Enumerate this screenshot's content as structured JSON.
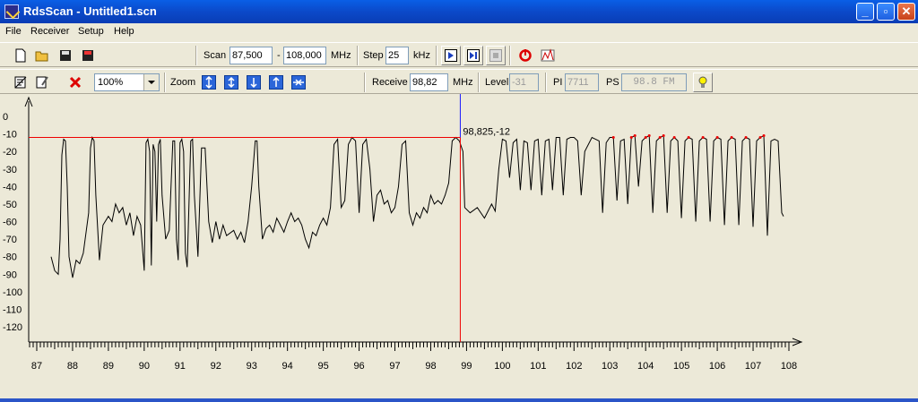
{
  "window": {
    "title": "RdsScan - Untitled1.scn"
  },
  "menu": [
    "File",
    "Receiver",
    "Setup",
    "Help"
  ],
  "toolbar1": {
    "scan_label": "Scan",
    "scan_from": "87,500",
    "scan_sep": "-",
    "scan_to": "108,000",
    "mhz_label": "MHz",
    "step_label": "Step",
    "step_value": "25",
    "khz_label": "kHz"
  },
  "toolbar2": {
    "zoom_value": "100%",
    "zoom_label": "Zoom",
    "receive_label": "Receive",
    "receive_value": "98,82",
    "mhz_label": "MHz",
    "level_label": "Level",
    "level_value": "-31",
    "pi_label": "PI",
    "pi_value": "7711",
    "ps_label": "PS",
    "ps_value": "98.8 FM"
  },
  "chart_data": {
    "type": "line",
    "xlabel": "",
    "ylabel": "",
    "xlim": [
      86.7,
      108.2
    ],
    "ylim": [
      -125,
      0
    ],
    "x_ticks": [
      "87",
      "88",
      "89",
      "90",
      "91",
      "92",
      "93",
      "94",
      "95",
      "96",
      "97",
      "98",
      "99",
      "100",
      "101",
      "102",
      "103",
      "104",
      "105",
      "106",
      "107",
      "108"
    ],
    "y_ticks": [
      "0",
      "-10",
      "-20",
      "-30",
      "-40",
      "-50",
      "-60",
      "-70",
      "-80",
      "-90",
      "-100",
      "-110",
      "-120"
    ],
    "cursor": {
      "x": 98.825,
      "y": -12,
      "label": "98,825,-12"
    },
    "series": [
      {
        "values": [
          [
            87.4,
            -80
          ],
          [
            87.5,
            -88
          ],
          [
            87.6,
            -90
          ],
          [
            87.65,
            -70
          ],
          [
            87.7,
            -22
          ],
          [
            87.75,
            -13
          ],
          [
            87.8,
            -14
          ],
          [
            87.85,
            -40
          ],
          [
            87.9,
            -80
          ],
          [
            88.0,
            -92
          ],
          [
            88.1,
            -82
          ],
          [
            88.2,
            -84
          ],
          [
            88.3,
            -78
          ],
          [
            88.45,
            -55
          ],
          [
            88.5,
            -18
          ],
          [
            88.55,
            -12
          ],
          [
            88.6,
            -14
          ],
          [
            88.65,
            -45
          ],
          [
            88.75,
            -82
          ],
          [
            88.85,
            -62
          ],
          [
            89.0,
            -57
          ],
          [
            89.1,
            -60
          ],
          [
            89.2,
            -50
          ],
          [
            89.3,
            -55
          ],
          [
            89.4,
            -52
          ],
          [
            89.5,
            -62
          ],
          [
            89.6,
            -55
          ],
          [
            89.7,
            -68
          ],
          [
            89.8,
            -57
          ],
          [
            89.9,
            -62
          ],
          [
            90.0,
            -88
          ],
          [
            90.05,
            -15
          ],
          [
            90.1,
            -13
          ],
          [
            90.15,
            -20
          ],
          [
            90.2,
            -85
          ],
          [
            90.25,
            -16
          ],
          [
            90.3,
            -20
          ],
          [
            90.35,
            -60
          ],
          [
            90.4,
            -16
          ],
          [
            90.45,
            -13
          ],
          [
            90.5,
            -45
          ],
          [
            90.6,
            -70
          ],
          [
            90.7,
            -65
          ],
          [
            90.8,
            -14
          ],
          [
            90.85,
            -14
          ],
          [
            90.9,
            -70
          ],
          [
            90.95,
            -82
          ],
          [
            91.0,
            -15
          ],
          [
            91.05,
            -13
          ],
          [
            91.1,
            -20
          ],
          [
            91.15,
            -78
          ],
          [
            91.2,
            -86
          ],
          [
            91.3,
            -14
          ],
          [
            91.35,
            -13
          ],
          [
            91.4,
            -45
          ],
          [
            91.5,
            -80
          ],
          [
            91.6,
            -18
          ],
          [
            91.7,
            -18
          ],
          [
            91.8,
            -60
          ],
          [
            91.9,
            -72
          ],
          [
            92.0,
            -60
          ],
          [
            92.1,
            -70
          ],
          [
            92.2,
            -62
          ],
          [
            92.3,
            -68
          ],
          [
            92.5,
            -65
          ],
          [
            92.6,
            -70
          ],
          [
            92.7,
            -66
          ],
          [
            92.8,
            -72
          ],
          [
            92.9,
            -60
          ],
          [
            93.0,
            -40
          ],
          [
            93.1,
            -14
          ],
          [
            93.15,
            -14
          ],
          [
            93.2,
            -40
          ],
          [
            93.3,
            -70
          ],
          [
            93.4,
            -64
          ],
          [
            93.5,
            -62
          ],
          [
            93.6,
            -66
          ],
          [
            93.7,
            -58
          ],
          [
            93.8,
            -62
          ],
          [
            93.9,
            -66
          ],
          [
            94.0,
            -60
          ],
          [
            94.1,
            -55
          ],
          [
            94.2,
            -60
          ],
          [
            94.3,
            -58
          ],
          [
            94.4,
            -62
          ],
          [
            94.5,
            -70
          ],
          [
            94.6,
            -75
          ],
          [
            94.7,
            -66
          ],
          [
            94.8,
            -68
          ],
          [
            94.9,
            -62
          ],
          [
            95.0,
            -58
          ],
          [
            95.1,
            -62
          ],
          [
            95.2,
            -52
          ],
          [
            95.3,
            -16
          ],
          [
            95.4,
            -13
          ],
          [
            95.5,
            -52
          ],
          [
            95.6,
            -48
          ],
          [
            95.7,
            -16
          ],
          [
            95.8,
            -12
          ],
          [
            95.9,
            -14
          ],
          [
            96.0,
            -55
          ],
          [
            96.1,
            -16
          ],
          [
            96.2,
            -13
          ],
          [
            96.3,
            -30
          ],
          [
            96.4,
            -60
          ],
          [
            96.5,
            -45
          ],
          [
            96.6,
            -42
          ],
          [
            96.7,
            -50
          ],
          [
            96.8,
            -48
          ],
          [
            96.9,
            -55
          ],
          [
            97.0,
            -52
          ],
          [
            97.1,
            -40
          ],
          [
            97.2,
            -16
          ],
          [
            97.3,
            -14
          ],
          [
            97.4,
            -55
          ],
          [
            97.5,
            -62
          ],
          [
            97.6,
            -55
          ],
          [
            97.7,
            -58
          ],
          [
            97.8,
            -52
          ],
          [
            97.9,
            -55
          ],
          [
            98.0,
            -45
          ],
          [
            98.1,
            -50
          ],
          [
            98.2,
            -48
          ],
          [
            98.3,
            -50
          ],
          [
            98.4,
            -45
          ],
          [
            98.5,
            -38
          ],
          [
            98.6,
            -14
          ],
          [
            98.7,
            -12
          ],
          [
            98.8,
            -14
          ],
          [
            98.9,
            -20
          ],
          [
            98.95,
            -52
          ],
          [
            99.1,
            -55
          ],
          [
            99.3,
            -52
          ],
          [
            99.5,
            -58
          ],
          [
            99.7,
            -50
          ],
          [
            99.8,
            -54
          ],
          [
            99.9,
            -30
          ],
          [
            100.0,
            -13
          ],
          [
            100.1,
            -14
          ],
          [
            100.2,
            -35
          ],
          [
            100.3,
            -15
          ],
          [
            100.4,
            -13
          ],
          [
            100.5,
            -42
          ],
          [
            100.6,
            -14
          ],
          [
            100.7,
            -15
          ],
          [
            100.8,
            -42
          ],
          [
            100.9,
            -14
          ],
          [
            101.0,
            -13
          ],
          [
            101.1,
            -45
          ],
          [
            101.2,
            -14
          ],
          [
            101.3,
            -13
          ],
          [
            101.4,
            -42
          ],
          [
            101.5,
            -12
          ],
          [
            101.6,
            -12
          ],
          [
            101.7,
            -45
          ],
          [
            101.8,
            -13
          ],
          [
            101.9,
            -12
          ],
          [
            102.0,
            -12
          ],
          [
            102.1,
            -14
          ],
          [
            102.2,
            -45
          ],
          [
            102.3,
            -20
          ],
          [
            102.5,
            -12
          ],
          [
            102.7,
            -14
          ],
          [
            102.8,
            -55
          ],
          [
            102.9,
            -15
          ],
          [
            103.0,
            -12
          ],
          [
            103.1,
            -12
          ],
          [
            103.2,
            -48
          ],
          [
            103.3,
            -14
          ],
          [
            103.4,
            -13
          ],
          [
            103.5,
            -50
          ],
          [
            103.6,
            -12
          ],
          [
            103.7,
            -11
          ],
          [
            103.8,
            -40
          ],
          [
            103.9,
            -14
          ],
          [
            104.0,
            -12
          ],
          [
            104.1,
            -11
          ],
          [
            104.2,
            -55
          ],
          [
            104.3,
            -14
          ],
          [
            104.4,
            -12
          ],
          [
            104.5,
            -11
          ],
          [
            104.6,
            -55
          ],
          [
            104.7,
            -14
          ],
          [
            104.8,
            -12
          ],
          [
            104.9,
            -14
          ],
          [
            105.0,
            -58
          ],
          [
            105.1,
            -14
          ],
          [
            105.2,
            -12
          ],
          [
            105.3,
            -13
          ],
          [
            105.4,
            -60
          ],
          [
            105.5,
            -14
          ],
          [
            105.6,
            -12
          ],
          [
            105.7,
            -13
          ],
          [
            105.8,
            -60
          ],
          [
            105.9,
            -14
          ],
          [
            106.0,
            -12
          ],
          [
            106.1,
            -13
          ],
          [
            106.2,
            -62
          ],
          [
            106.3,
            -14
          ],
          [
            106.4,
            -12
          ],
          [
            106.5,
            -13
          ],
          [
            106.6,
            -62
          ],
          [
            106.7,
            -14
          ],
          [
            106.8,
            -12
          ],
          [
            106.9,
            -13
          ],
          [
            107.0,
            -63
          ],
          [
            107.1,
            -14
          ],
          [
            107.2,
            -12
          ],
          [
            107.3,
            -11
          ],
          [
            107.4,
            -68
          ],
          [
            107.5,
            -14
          ],
          [
            107.6,
            -13
          ],
          [
            107.7,
            -14
          ],
          [
            107.8,
            -55
          ],
          [
            107.85,
            -57
          ]
        ]
      }
    ]
  }
}
